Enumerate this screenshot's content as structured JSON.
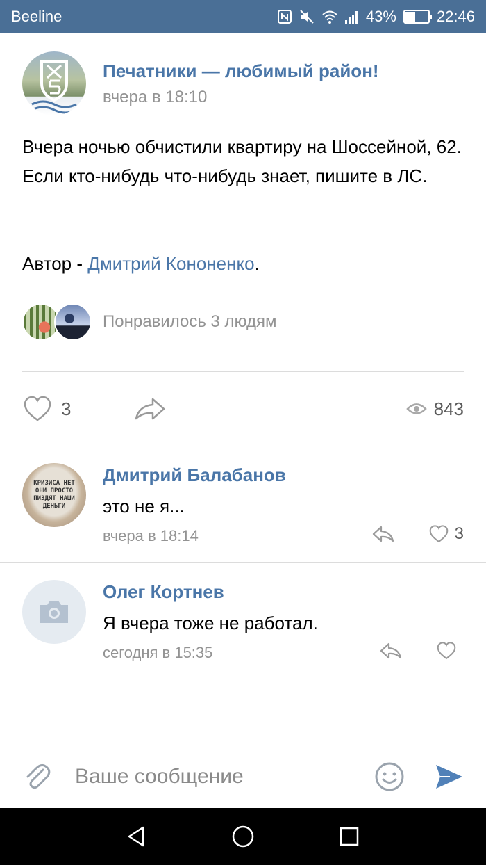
{
  "status_bar": {
    "carrier": "Beeline",
    "battery": "43%",
    "battery_level": 0.43,
    "time": "22:46",
    "icons": [
      "nfc-icon",
      "mute-icon",
      "wifi-icon",
      "signal-icon",
      "battery-icon"
    ]
  },
  "post": {
    "group_name": "Печатники — любимый район!",
    "time": "вчера в 18:10",
    "text": "Вчера ночью обчистили квартиру на Шоссейной, 62. Если кто-нибудь что-нибудь знает, пишите в ЛС.",
    "author_prefix": "Автор - ",
    "author_name": "Дмитрий Кононенко",
    "author_suffix": ".",
    "likes_text": "Понравилось 3 людям",
    "like_count": "3",
    "views": "843"
  },
  "comments": [
    {
      "name": "Дмитрий Балабанов",
      "text": "это не я...",
      "time": "вчера в 18:14",
      "likes": "3",
      "avatar_text": "КРИЗИСА НЕТ ОНИ ПРОСТО ПИЗДЯТ НАШИ ДЕНЬГИ"
    },
    {
      "name": "Олег Кортнев",
      "text": "Я вчера тоже не работал.",
      "time": "сегодня в 15:35",
      "likes": ""
    }
  ],
  "composer": {
    "placeholder": "Ваше сообщение"
  },
  "colors": {
    "accent": "#4a76a8",
    "status_bar": "#4a6f96",
    "secondary_text": "#939393"
  }
}
